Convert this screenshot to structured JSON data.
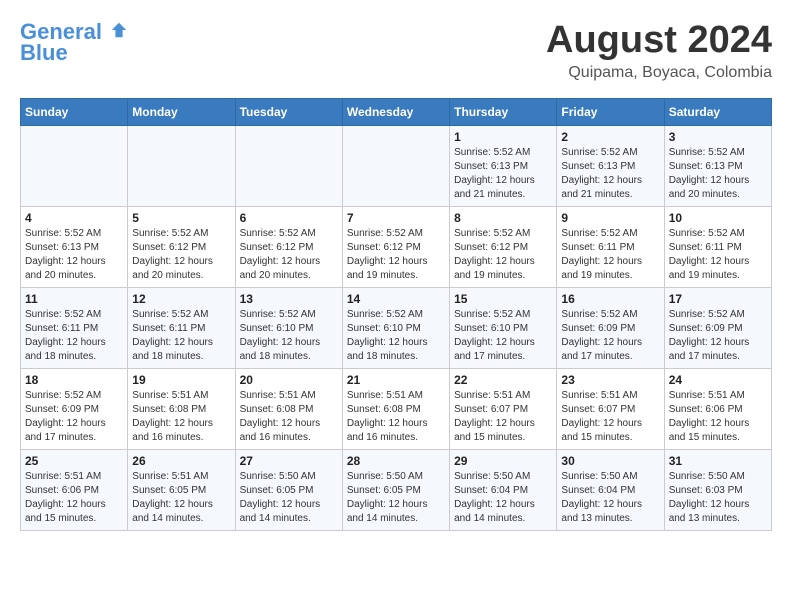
{
  "logo": {
    "line1": "General",
    "line2": "Blue"
  },
  "title": "August 2024",
  "subtitle": "Quipama, Boyaca, Colombia",
  "weekdays": [
    "Sunday",
    "Monday",
    "Tuesday",
    "Wednesday",
    "Thursday",
    "Friday",
    "Saturday"
  ],
  "weeks": [
    [
      {
        "day": "",
        "detail": ""
      },
      {
        "day": "",
        "detail": ""
      },
      {
        "day": "",
        "detail": ""
      },
      {
        "day": "",
        "detail": ""
      },
      {
        "day": "1",
        "detail": "Sunrise: 5:52 AM\nSunset: 6:13 PM\nDaylight: 12 hours\nand 21 minutes."
      },
      {
        "day": "2",
        "detail": "Sunrise: 5:52 AM\nSunset: 6:13 PM\nDaylight: 12 hours\nand 21 minutes."
      },
      {
        "day": "3",
        "detail": "Sunrise: 5:52 AM\nSunset: 6:13 PM\nDaylight: 12 hours\nand 20 minutes."
      }
    ],
    [
      {
        "day": "4",
        "detail": "Sunrise: 5:52 AM\nSunset: 6:13 PM\nDaylight: 12 hours\nand 20 minutes."
      },
      {
        "day": "5",
        "detail": "Sunrise: 5:52 AM\nSunset: 6:12 PM\nDaylight: 12 hours\nand 20 minutes."
      },
      {
        "day": "6",
        "detail": "Sunrise: 5:52 AM\nSunset: 6:12 PM\nDaylight: 12 hours\nand 20 minutes."
      },
      {
        "day": "7",
        "detail": "Sunrise: 5:52 AM\nSunset: 6:12 PM\nDaylight: 12 hours\nand 19 minutes."
      },
      {
        "day": "8",
        "detail": "Sunrise: 5:52 AM\nSunset: 6:12 PM\nDaylight: 12 hours\nand 19 minutes."
      },
      {
        "day": "9",
        "detail": "Sunrise: 5:52 AM\nSunset: 6:11 PM\nDaylight: 12 hours\nand 19 minutes."
      },
      {
        "day": "10",
        "detail": "Sunrise: 5:52 AM\nSunset: 6:11 PM\nDaylight: 12 hours\nand 19 minutes."
      }
    ],
    [
      {
        "day": "11",
        "detail": "Sunrise: 5:52 AM\nSunset: 6:11 PM\nDaylight: 12 hours\nand 18 minutes."
      },
      {
        "day": "12",
        "detail": "Sunrise: 5:52 AM\nSunset: 6:11 PM\nDaylight: 12 hours\nand 18 minutes."
      },
      {
        "day": "13",
        "detail": "Sunrise: 5:52 AM\nSunset: 6:10 PM\nDaylight: 12 hours\nand 18 minutes."
      },
      {
        "day": "14",
        "detail": "Sunrise: 5:52 AM\nSunset: 6:10 PM\nDaylight: 12 hours\nand 18 minutes."
      },
      {
        "day": "15",
        "detail": "Sunrise: 5:52 AM\nSunset: 6:10 PM\nDaylight: 12 hours\nand 17 minutes."
      },
      {
        "day": "16",
        "detail": "Sunrise: 5:52 AM\nSunset: 6:09 PM\nDaylight: 12 hours\nand 17 minutes."
      },
      {
        "day": "17",
        "detail": "Sunrise: 5:52 AM\nSunset: 6:09 PM\nDaylight: 12 hours\nand 17 minutes."
      }
    ],
    [
      {
        "day": "18",
        "detail": "Sunrise: 5:52 AM\nSunset: 6:09 PM\nDaylight: 12 hours\nand 17 minutes."
      },
      {
        "day": "19",
        "detail": "Sunrise: 5:51 AM\nSunset: 6:08 PM\nDaylight: 12 hours\nand 16 minutes."
      },
      {
        "day": "20",
        "detail": "Sunrise: 5:51 AM\nSunset: 6:08 PM\nDaylight: 12 hours\nand 16 minutes."
      },
      {
        "day": "21",
        "detail": "Sunrise: 5:51 AM\nSunset: 6:08 PM\nDaylight: 12 hours\nand 16 minutes."
      },
      {
        "day": "22",
        "detail": "Sunrise: 5:51 AM\nSunset: 6:07 PM\nDaylight: 12 hours\nand 15 minutes."
      },
      {
        "day": "23",
        "detail": "Sunrise: 5:51 AM\nSunset: 6:07 PM\nDaylight: 12 hours\nand 15 minutes."
      },
      {
        "day": "24",
        "detail": "Sunrise: 5:51 AM\nSunset: 6:06 PM\nDaylight: 12 hours\nand 15 minutes."
      }
    ],
    [
      {
        "day": "25",
        "detail": "Sunrise: 5:51 AM\nSunset: 6:06 PM\nDaylight: 12 hours\nand 15 minutes."
      },
      {
        "day": "26",
        "detail": "Sunrise: 5:51 AM\nSunset: 6:05 PM\nDaylight: 12 hours\nand 14 minutes."
      },
      {
        "day": "27",
        "detail": "Sunrise: 5:50 AM\nSunset: 6:05 PM\nDaylight: 12 hours\nand 14 minutes."
      },
      {
        "day": "28",
        "detail": "Sunrise: 5:50 AM\nSunset: 6:05 PM\nDaylight: 12 hours\nand 14 minutes."
      },
      {
        "day": "29",
        "detail": "Sunrise: 5:50 AM\nSunset: 6:04 PM\nDaylight: 12 hours\nand 14 minutes."
      },
      {
        "day": "30",
        "detail": "Sunrise: 5:50 AM\nSunset: 6:04 PM\nDaylight: 12 hours\nand 13 minutes."
      },
      {
        "day": "31",
        "detail": "Sunrise: 5:50 AM\nSunset: 6:03 PM\nDaylight: 12 hours\nand 13 minutes."
      }
    ]
  ]
}
